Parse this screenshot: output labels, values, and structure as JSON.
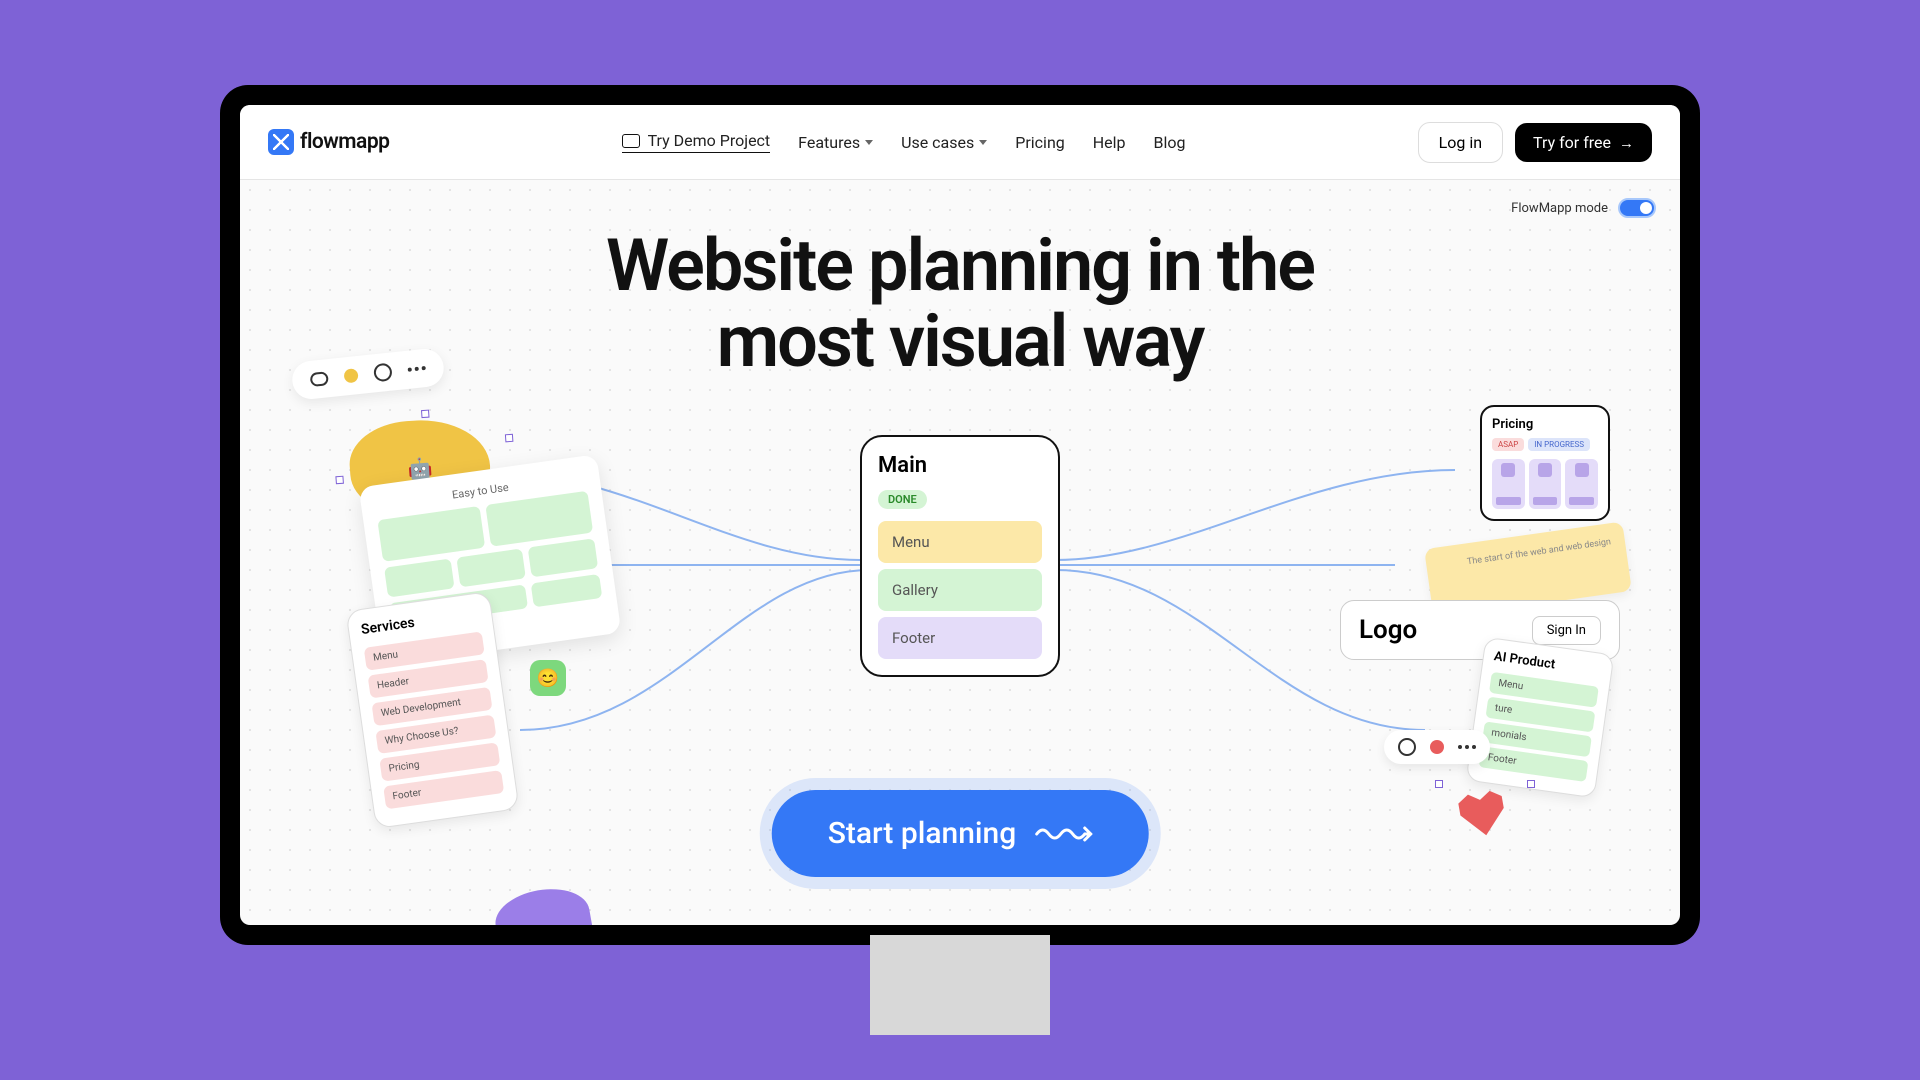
{
  "brand": "flowmapp",
  "nav": {
    "demo": "Try Demo Project",
    "features": "Features",
    "usecases": "Use cases",
    "pricing": "Pricing",
    "help": "Help",
    "blog": "Blog",
    "login": "Log in",
    "tryfree": "Try for free"
  },
  "mode_label": "FlowMapp mode",
  "hero_line1": "Website planning in the",
  "hero_line2": "most visual way",
  "main_card": {
    "title": "Main",
    "status": "DONE",
    "sections": {
      "menu": "Menu",
      "gallery": "Gallery",
      "footer": "Footer"
    }
  },
  "cta": "Start planning",
  "wireframe_title": "Easy to Use",
  "services": {
    "title": "Services",
    "items": [
      "Menu",
      "Header",
      "Web Development",
      "Why Choose Us?",
      "Pricing",
      "Footer"
    ]
  },
  "pricing_card": {
    "title": "Pricing",
    "tag_asap": "ASAP",
    "tag_progress": "IN PROGRESS"
  },
  "note_text": "The start of the web and web design",
  "logo_card": {
    "title": "Logo",
    "signin": "Sign In"
  },
  "ai_card": {
    "title": "AI Product",
    "items": [
      "Menu",
      "ture",
      "monials",
      "Footer"
    ]
  }
}
